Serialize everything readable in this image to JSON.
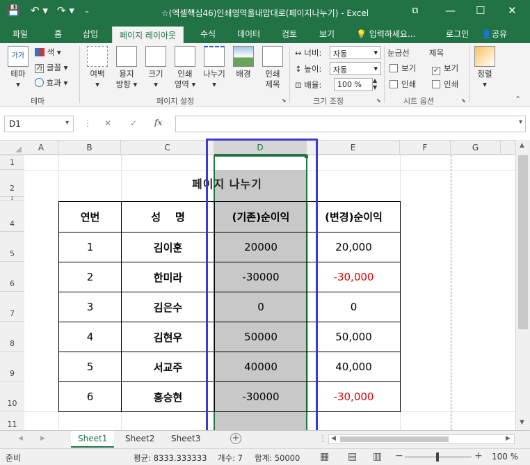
{
  "window": {
    "title": "☆(엑셀핵심46)인쇄영역을내맘대로(페이지나누기) - Excel",
    "qa_save": "💾",
    "qa_undo": "↶ ▾",
    "qa_redo": "↷ ▾",
    "qa_custom": "₌"
  },
  "tabs": [
    "파일",
    "홈",
    "삽입",
    "페이지 레이아웃",
    "수식",
    "데이터",
    "검토",
    "보기"
  ],
  "tell_me": "입력하세요...",
  "login": "로그인",
  "share": "공유",
  "ribbon": {
    "theme": {
      "theme_btn": "테마",
      "theme_icon": "가가",
      "colors": "색 ▾",
      "fonts": "글꼴 ▾",
      "effects": "효과 ▾",
      "group": "테마"
    },
    "page_setup": {
      "margins": "여백",
      "orientation": [
        "용지",
        "방향 ▾"
      ],
      "size": "크기",
      "print_area": [
        "인쇄",
        "영역 ▾"
      ],
      "breaks": "나누기",
      "background": "배경",
      "print_titles": [
        "인쇄",
        "제목"
      ],
      "group": "페이지 설정"
    },
    "scale": {
      "width_label": "너비:",
      "width_value": "자동",
      "height_label": "높이:",
      "height_value": "자동",
      "scale_label": "배율:",
      "scale_value": "100 %",
      "group": "크기 조정"
    },
    "sheet_options": {
      "gridlines": "눈금선",
      "headings": "제목",
      "view": "보기",
      "print": "인쇄",
      "group": "시트 옵션"
    },
    "arrange": {
      "label": "정렬"
    }
  },
  "formula_bar": {
    "name_box": "D1",
    "cancel": "✕",
    "enter": "✓",
    "fx": "fx",
    "value": ""
  },
  "columns": [
    "A",
    "B",
    "C",
    "D",
    "E",
    "F",
    "G"
  ],
  "rows": [
    "1",
    "2",
    "3",
    "4",
    "5",
    "6",
    "7",
    "8",
    "9",
    "10",
    "11"
  ],
  "sheet": {
    "title": "페이지 나누기",
    "headers": [
      "연번",
      "성    명",
      "(기존)순이익",
      "(변경)순이익"
    ],
    "records": [
      {
        "no": "1",
        "name": "김이훈",
        "old": "20000",
        "new": "20,000",
        "neg": false
      },
      {
        "no": "2",
        "name": "한미라",
        "old": "-30000",
        "new": "-30,000",
        "neg": true
      },
      {
        "no": "3",
        "name": "김은수",
        "old": "0",
        "new": "0",
        "neg": false
      },
      {
        "no": "4",
        "name": "김현우",
        "old": "50000",
        "new": "50,000",
        "neg": false
      },
      {
        "no": "5",
        "name": "서교주",
        "old": "40000",
        "new": "40,000",
        "neg": false
      },
      {
        "no": "6",
        "name": "홍승현",
        "old": "-30000",
        "new": "-30,000",
        "neg": true
      }
    ]
  },
  "sheet_tabs": [
    "Sheet1",
    "Sheet2",
    "Sheet3"
  ],
  "status": {
    "ready": "준비",
    "average": "평균: 8333.333333",
    "count": "개수: 7",
    "sum": "합계: 50000",
    "zoom": "100 %"
  },
  "colors": {
    "excel_green": "#217346",
    "highlight_frame": "#3c3ccc",
    "negative": "#e00000",
    "selected_fill": "#c8c8c8"
  }
}
